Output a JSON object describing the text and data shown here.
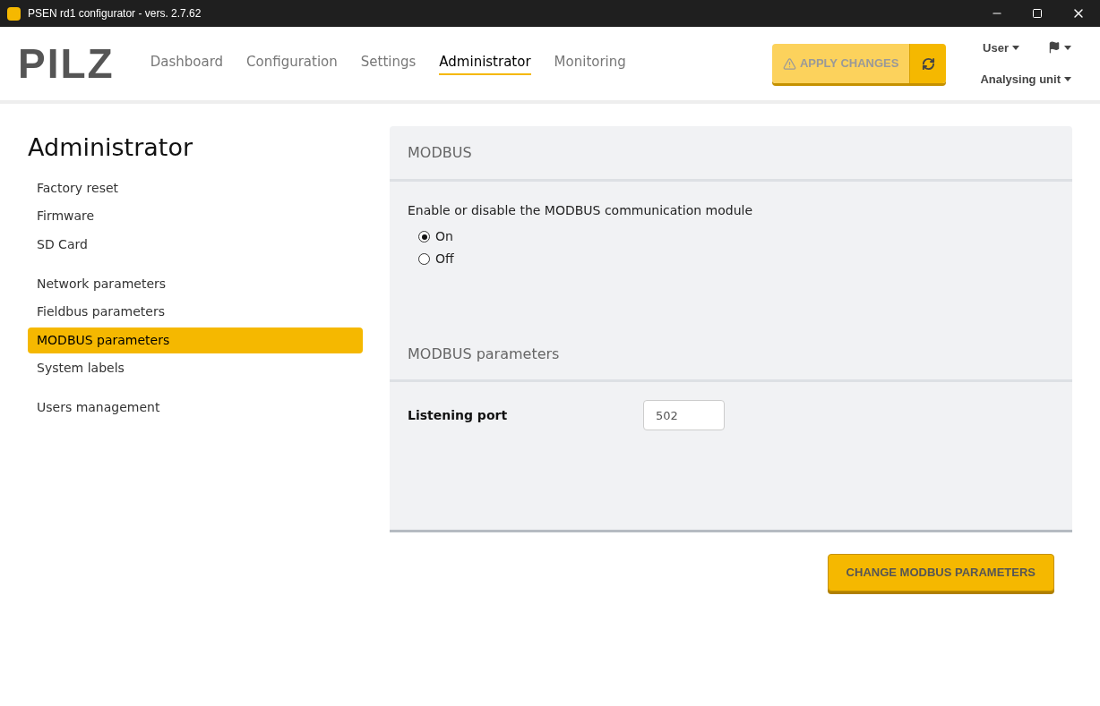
{
  "window": {
    "title": "PSEN rd1 configurator - vers. 2.7.62"
  },
  "logo": "PILZ",
  "nav": [
    {
      "label": "Dashboard",
      "selected": false
    },
    {
      "label": "Configuration",
      "selected": false
    },
    {
      "label": "Settings",
      "selected": false
    },
    {
      "label": "Administrator",
      "selected": true
    },
    {
      "label": "Monitoring",
      "selected": false
    }
  ],
  "apply_button": {
    "label": "APPLY CHANGES",
    "disabled": true
  },
  "user_menu": "User",
  "unit_menu": "Analysing unit",
  "sidebar": {
    "title": "Administrator",
    "groups": [
      [
        {
          "label": "Factory reset",
          "selected": false
        },
        {
          "label": "Firmware",
          "selected": false
        },
        {
          "label": "SD Card",
          "selected": false
        }
      ],
      [
        {
          "label": "Network parameters",
          "selected": false
        },
        {
          "label": "Fieldbus parameters",
          "selected": false
        },
        {
          "label": "MODBUS parameters",
          "selected": true
        },
        {
          "label": "System labels",
          "selected": false
        }
      ],
      [
        {
          "label": "Users management",
          "selected": false
        }
      ]
    ]
  },
  "modbus": {
    "title": "MODBUS",
    "description": "Enable or disable the MODBUS communication module",
    "options": [
      {
        "label": "On",
        "selected": true
      },
      {
        "label": "Off",
        "selected": false
      }
    ]
  },
  "parameters": {
    "title": "MODBUS parameters",
    "fields": [
      {
        "label": "Listening port",
        "value": "502"
      }
    ]
  },
  "submit_button": "CHANGE MODBUS PARAMETERS"
}
